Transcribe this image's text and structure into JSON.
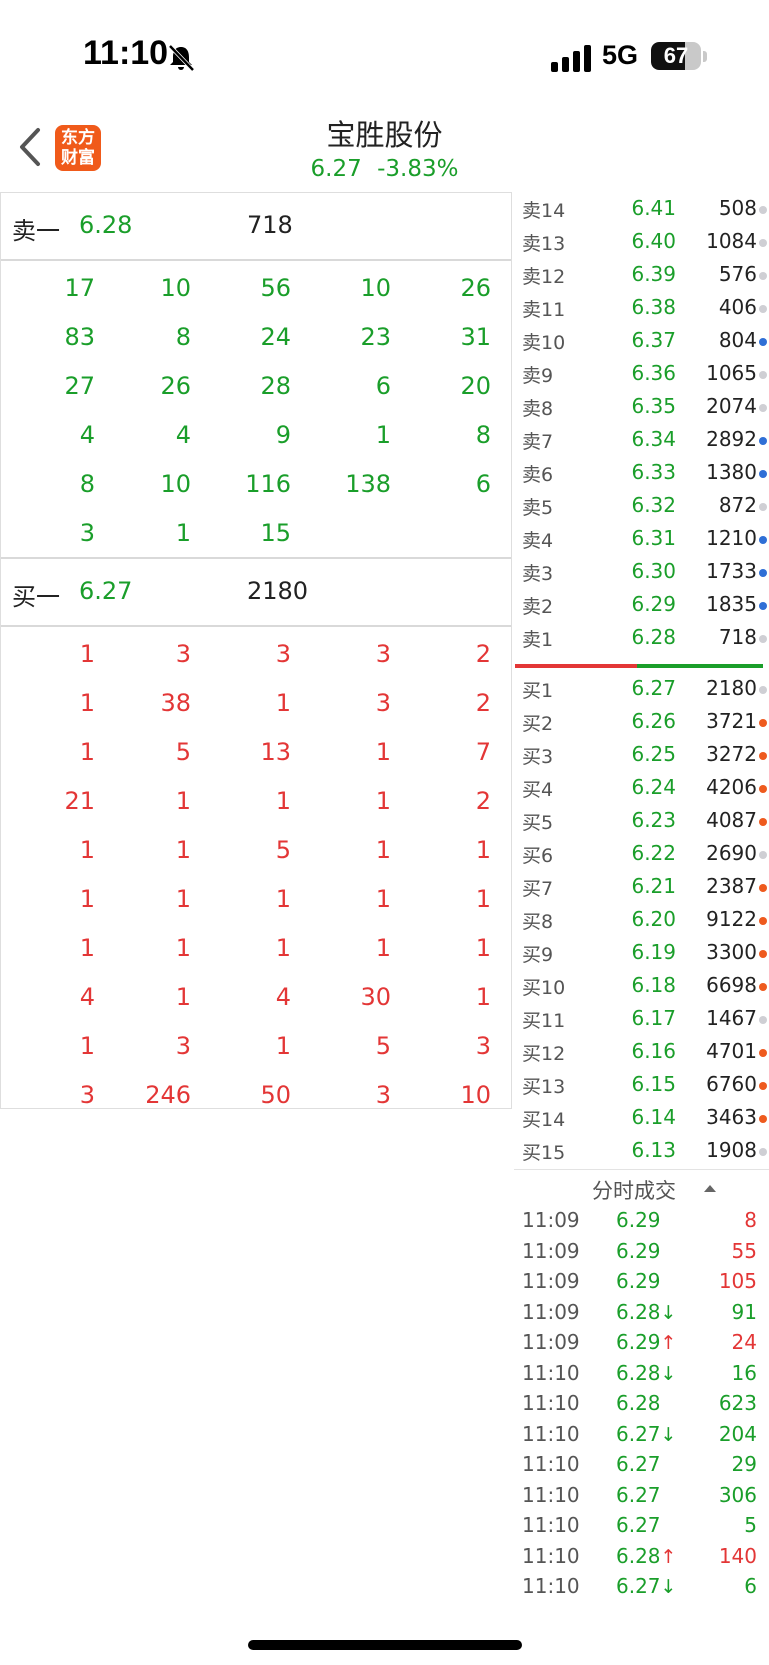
{
  "status_bar": {
    "time": "11:10",
    "network": "5G",
    "battery": "67"
  },
  "header": {
    "logo_line1": "东方",
    "logo_line2": "财富",
    "title": "宝胜股份",
    "price": "6.27",
    "change": "-3.83%"
  },
  "sell1": {
    "label": "卖一",
    "price": "6.28",
    "volume": "718"
  },
  "sell_queue": [
    [
      "17",
      "10",
      "56",
      "10",
      "26"
    ],
    [
      "83",
      "8",
      "24",
      "23",
      "31"
    ],
    [
      "27",
      "26",
      "28",
      "6",
      "20"
    ],
    [
      "4",
      "4",
      "9",
      "1",
      "8"
    ],
    [
      "8",
      "10",
      "116",
      "138",
      "6"
    ],
    [
      "3",
      "1",
      "15",
      "",
      ""
    ]
  ],
  "buy1": {
    "label": "买一",
    "price": "6.27",
    "volume": "2180"
  },
  "buy_queue": [
    [
      "1",
      "3",
      "3",
      "3",
      "2"
    ],
    [
      "1",
      "38",
      "1",
      "3",
      "2"
    ],
    [
      "1",
      "5",
      "13",
      "1",
      "7"
    ],
    [
      "21",
      "1",
      "1",
      "1",
      "2"
    ],
    [
      "1",
      "1",
      "5",
      "1",
      "1"
    ],
    [
      "1",
      "1",
      "1",
      "1",
      "1"
    ],
    [
      "1",
      "1",
      "1",
      "1",
      "1"
    ],
    [
      "4",
      "1",
      "4",
      "30",
      "1"
    ],
    [
      "1",
      "3",
      "1",
      "5",
      "3"
    ],
    [
      "3",
      "246",
      "50",
      "3",
      "10"
    ]
  ],
  "order_book": {
    "asks": [
      {
        "label": "卖14",
        "price": "6.41",
        "volume": "508",
        "dot": "gray"
      },
      {
        "label": "卖13",
        "price": "6.40",
        "volume": "1084",
        "dot": "gray"
      },
      {
        "label": "卖12",
        "price": "6.39",
        "volume": "576",
        "dot": "gray"
      },
      {
        "label": "卖11",
        "price": "6.38",
        "volume": "406",
        "dot": "gray"
      },
      {
        "label": "卖10",
        "price": "6.37",
        "volume": "804",
        "dot": "blue"
      },
      {
        "label": "卖9",
        "price": "6.36",
        "volume": "1065",
        "dot": "gray"
      },
      {
        "label": "卖8",
        "price": "6.35",
        "volume": "2074",
        "dot": "gray"
      },
      {
        "label": "卖7",
        "price": "6.34",
        "volume": "2892",
        "dot": "blue"
      },
      {
        "label": "卖6",
        "price": "6.33",
        "volume": "1380",
        "dot": "blue"
      },
      {
        "label": "卖5",
        "price": "6.32",
        "volume": "872",
        "dot": "gray"
      },
      {
        "label": "卖4",
        "price": "6.31",
        "volume": "1210",
        "dot": "blue"
      },
      {
        "label": "卖3",
        "price": "6.30",
        "volume": "1733",
        "dot": "blue"
      },
      {
        "label": "卖2",
        "price": "6.29",
        "volume": "1835",
        "dot": "blue"
      },
      {
        "label": "卖1",
        "price": "6.28",
        "volume": "718",
        "dot": "gray"
      }
    ],
    "bids": [
      {
        "label": "买1",
        "price": "6.27",
        "volume": "2180",
        "dot": "gray"
      },
      {
        "label": "买2",
        "price": "6.26",
        "volume": "3721",
        "dot": "orange"
      },
      {
        "label": "买3",
        "price": "6.25",
        "volume": "3272",
        "dot": "orange"
      },
      {
        "label": "买4",
        "price": "6.24",
        "volume": "4206",
        "dot": "orange"
      },
      {
        "label": "买5",
        "price": "6.23",
        "volume": "4087",
        "dot": "orange"
      },
      {
        "label": "买6",
        "price": "6.22",
        "volume": "2690",
        "dot": "gray"
      },
      {
        "label": "买7",
        "price": "6.21",
        "volume": "2387",
        "dot": "orange"
      },
      {
        "label": "买8",
        "price": "6.20",
        "volume": "9122",
        "dot": "orange"
      },
      {
        "label": "买9",
        "price": "6.19",
        "volume": "3300",
        "dot": "orange"
      },
      {
        "label": "买10",
        "price": "6.18",
        "volume": "6698",
        "dot": "orange"
      },
      {
        "label": "买11",
        "price": "6.17",
        "volume": "1467",
        "dot": "gray"
      },
      {
        "label": "买12",
        "price": "6.16",
        "volume": "4701",
        "dot": "orange"
      },
      {
        "label": "买13",
        "price": "6.15",
        "volume": "6760",
        "dot": "orange"
      },
      {
        "label": "买14",
        "price": "6.14",
        "volume": "3463",
        "dot": "orange"
      },
      {
        "label": "买15",
        "price": "6.13",
        "volume": "1908",
        "dot": "gray"
      }
    ]
  },
  "ticks_title": "分时成交",
  "ticks": [
    {
      "time": "11:09",
      "price": "6.29",
      "arrow": "",
      "volume": "8",
      "side": "buy"
    },
    {
      "time": "11:09",
      "price": "6.29",
      "arrow": "",
      "volume": "55",
      "side": "buy"
    },
    {
      "time": "11:09",
      "price": "6.29",
      "arrow": "",
      "volume": "105",
      "side": "buy"
    },
    {
      "time": "11:09",
      "price": "6.28",
      "arrow": "↓",
      "volume": "91",
      "side": "sell"
    },
    {
      "time": "11:09",
      "price": "6.29",
      "arrow": "↑",
      "volume": "24",
      "side": "buy"
    },
    {
      "time": "11:10",
      "price": "6.28",
      "arrow": "↓",
      "volume": "16",
      "side": "sell"
    },
    {
      "time": "11:10",
      "price": "6.28",
      "arrow": "",
      "volume": "623",
      "side": "sell"
    },
    {
      "time": "11:10",
      "price": "6.27",
      "arrow": "↓",
      "volume": "204",
      "side": "sell"
    },
    {
      "time": "11:10",
      "price": "6.27",
      "arrow": "",
      "volume": "29",
      "side": "sell"
    },
    {
      "time": "11:10",
      "price": "6.27",
      "arrow": "",
      "volume": "306",
      "side": "sell"
    },
    {
      "time": "11:10",
      "price": "6.27",
      "arrow": "",
      "volume": "5",
      "side": "sell"
    },
    {
      "time": "11:10",
      "price": "6.28",
      "arrow": "↑",
      "volume": "140",
      "side": "buy"
    },
    {
      "time": "11:10",
      "price": "6.27",
      "arrow": "↓",
      "volume": "6",
      "side": "sell"
    }
  ],
  "colors": {
    "up": "#e33636",
    "down": "#1a9e2a",
    "dot_gray": "#cfcfd4",
    "dot_blue": "#2f6fd6",
    "dot_orange": "#ee5a1e"
  }
}
